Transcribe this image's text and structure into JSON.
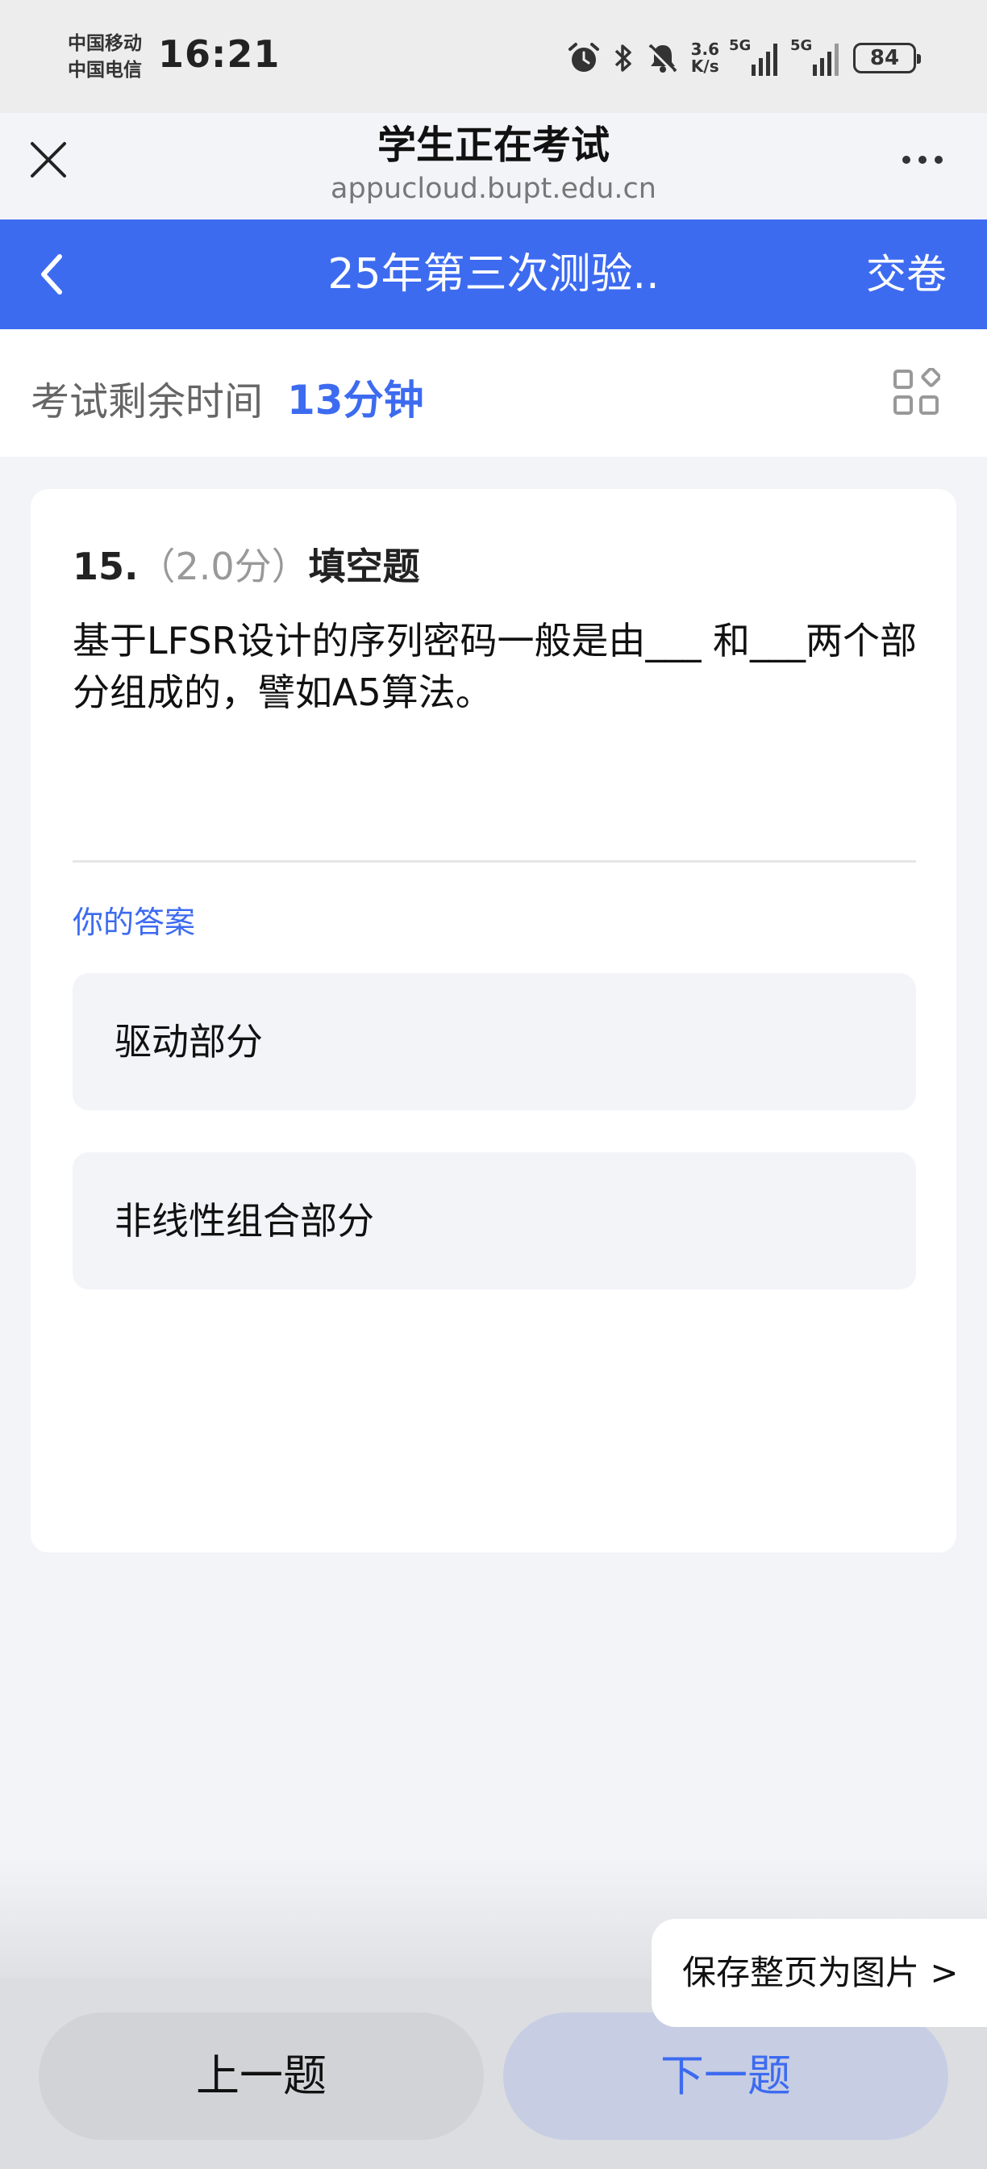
{
  "status_bar": {
    "carrier_1": "中国移动",
    "carrier_2": "中国电信",
    "time": "16:21",
    "net_speed_value": "3.6",
    "net_speed_unit": "K/s",
    "signal_1_label": "5G",
    "signal_2_label": "5G",
    "battery": "84",
    "icons": [
      "alarm-icon",
      "bluetooth-icon",
      "mute-icon"
    ]
  },
  "browser": {
    "title": "学生正在考试",
    "url": "appucloud.bupt.edu.cn"
  },
  "exam_header": {
    "title": "25年第三次测验..",
    "submit_label": "交卷"
  },
  "timer": {
    "label": "考试剩余时间",
    "value": "13分钟"
  },
  "question": {
    "number": "15.",
    "score": "（2.0分）",
    "type": "填空题",
    "text": "基于LFSR设计的序列密码一般是由___ 和___两个部分组成的，譬如A5算法。",
    "answer_label": "你的答案",
    "answers": [
      "驱动部分",
      "非线性组合部分"
    ]
  },
  "save_image_label": "保存整页为图片 >",
  "nav": {
    "prev_label": "上一题",
    "next_label": "下一题"
  },
  "colors": {
    "accent": "#3d6bf0",
    "background": "#f3f4f8"
  }
}
